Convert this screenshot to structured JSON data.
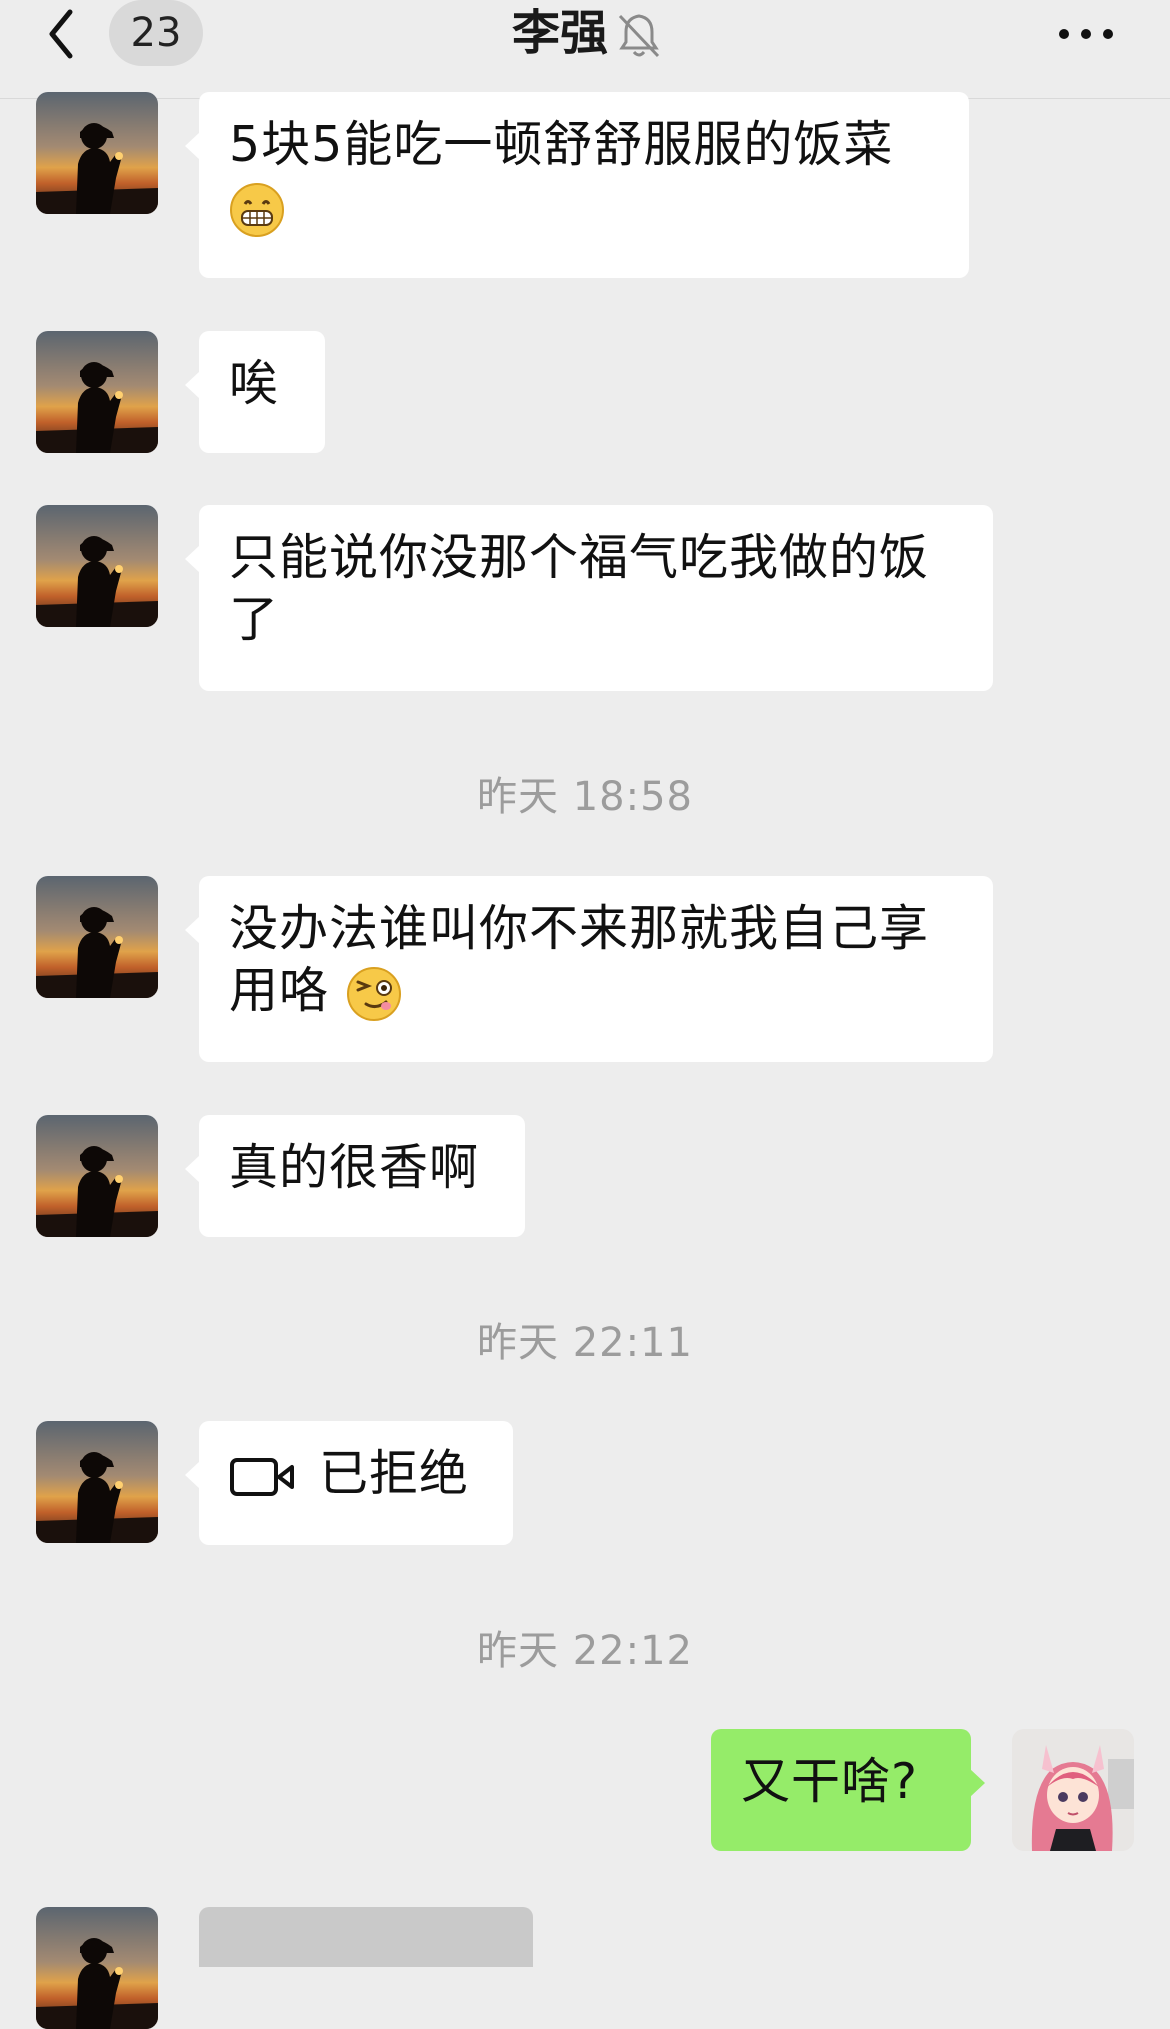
{
  "header": {
    "unread_count": "23",
    "title": "李强"
  },
  "messages": {
    "m1": "5块5能吃一顿舒舒服服的饭菜",
    "m2": "唉",
    "m3": "只能说你没那个福气吃我做的饭了",
    "ts1": "昨天 18:58",
    "m4": "没办法谁叫你不来那就我自己享用咯",
    "m5": "真的很香啊",
    "ts2": "昨天 22:11",
    "m6": "已拒绝",
    "ts3": "昨天 22:12",
    "m7": "又干啥?"
  },
  "icons": {
    "back": "chevron-left-icon",
    "mute": "bell-off-icon",
    "more": "more-dots-icon",
    "video_call": "video-camera-icon",
    "emoji_grin": "grinning-emoji",
    "emoji_wink": "winking-emoji"
  },
  "colors": {
    "background": "#ededed",
    "incoming_bubble": "#ffffff",
    "outgoing_bubble": "#95ec69",
    "timestamp_text": "#9c9c9c"
  }
}
